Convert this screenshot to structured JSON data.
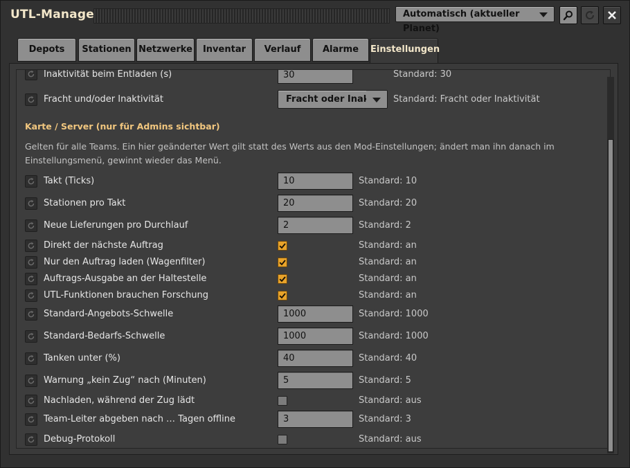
{
  "app": {
    "title": "UTL-Manager"
  },
  "header": {
    "planet_select": "Automatisch (aktueller Planet)",
    "search_icon": "magnifier-icon",
    "refresh_icon": "refresh-icon",
    "close_icon": "close-x-icon"
  },
  "tabs": [
    {
      "label": "Depots"
    },
    {
      "label": "Stationen"
    },
    {
      "label": "Netzwerke"
    },
    {
      "label": "Inventar"
    },
    {
      "label": "Verlauf"
    },
    {
      "label": "Alarme"
    },
    {
      "label": "Einstellungen",
      "active": true
    }
  ],
  "top_rows": [
    {
      "label": "Inaktivität beim Entladen (s)",
      "value": "30",
      "std": "Standard: 30"
    },
    {
      "label": "Fracht und/oder Inaktivität",
      "dropdown": "Fracht oder Inaktivi",
      "std": "Standard: Fracht oder Inaktivität"
    }
  ],
  "section": {
    "title": "Karte / Server (nur für Admins sichtbar)",
    "description": "Gelten für alle Teams. Ein hier geänderter Wert gilt statt des Werts aus den Mod-Einstellungen; ändert man ihn danach im Einstellungsmenü, gewinnt wieder das Menü."
  },
  "settings": [
    {
      "label": "Takt (Ticks)",
      "type": "number",
      "value": "10",
      "std": "Standard: 10"
    },
    {
      "label": "Stationen pro Takt",
      "type": "number",
      "value": "20",
      "std": "Standard: 20"
    },
    {
      "label": "Neue Lieferungen pro Durchlauf",
      "type": "number",
      "value": "2",
      "std": "Standard: 2"
    },
    {
      "label": "Direkt der nächste Auftrag",
      "type": "check",
      "checked": true,
      "std": "Standard: an"
    },
    {
      "label": "Nur den Auftrag laden (Wagenfilter)",
      "type": "check",
      "checked": true,
      "std": "Standard: an"
    },
    {
      "label": "Auftrags-Ausgabe an der Haltestelle",
      "type": "check",
      "checked": true,
      "std": "Standard: an"
    },
    {
      "label": "UTL-Funktionen brauchen Forschung",
      "type": "check",
      "checked": true,
      "std": "Standard: an"
    },
    {
      "label": "Standard-Angebots-Schwelle",
      "type": "number",
      "value": "1000",
      "std": "Standard: 1000"
    },
    {
      "label": "Standard-Bedarfs-Schwelle",
      "type": "number",
      "value": "1000",
      "std": "Standard: 1000"
    },
    {
      "label": "Tanken unter (%)",
      "type": "number",
      "value": "40",
      "std": "Standard: 40"
    },
    {
      "label": "Warnung „kein Zug“ nach (Minuten)",
      "type": "number",
      "value": "5",
      "std": "Standard: 5"
    },
    {
      "label": "Nachladen, während der Zug lädt",
      "type": "check",
      "checked": false,
      "std": "Standard: aus"
    },
    {
      "label": "Team-Leiter abgeben nach … Tagen offline",
      "type": "number",
      "value": "3",
      "std": "Standard: 3"
    },
    {
      "label": "Debug-Protokoll",
      "type": "check",
      "checked": false,
      "std": "Standard: aus"
    }
  ],
  "colors": {
    "accent_heading": "#f2c77f",
    "checkbox_on": "#e8a32a",
    "title_text": "#f2e6c9"
  }
}
